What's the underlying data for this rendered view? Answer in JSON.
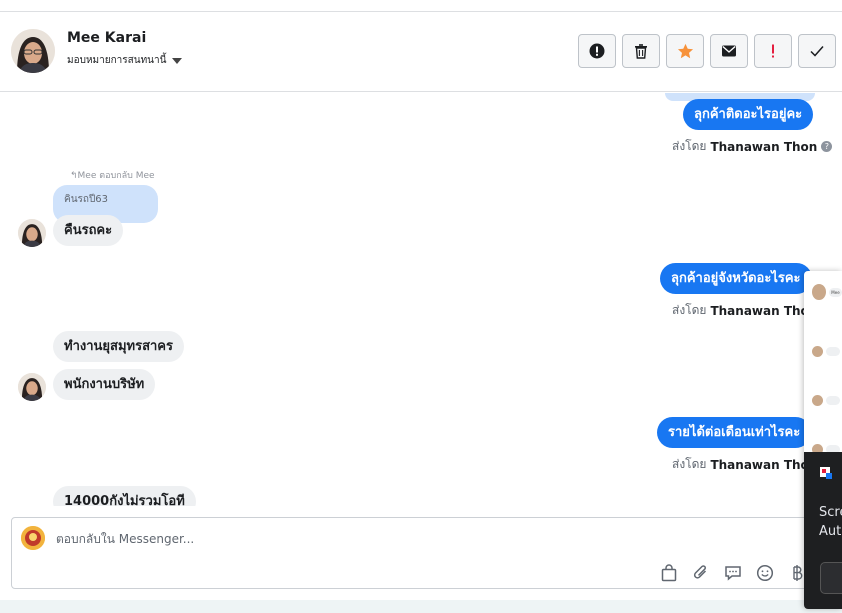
{
  "header": {
    "contact_name": "Mee Karai",
    "assign_label": "มอบหมายการสนทนานี้",
    "actions": [
      {
        "name": "spam-icon",
        "color": "#1c1e21"
      },
      {
        "name": "trash-icon",
        "color": "#1c1e21"
      },
      {
        "name": "star-icon",
        "color": "#f7923a"
      },
      {
        "name": "envelope-icon",
        "color": "#1c1e21"
      },
      {
        "name": "exclamation-icon",
        "color": "#e41e3f"
      },
      {
        "name": "check-icon",
        "color": "#1c1e21"
      }
    ]
  },
  "messages": {
    "out_1": "ลุกค้าติดอะไรอยู่คะ",
    "sent_by_prefix": "ส่งโดย",
    "agent_name": "Thanawan Thon",
    "reply_label": "Mee ตอบกลับ Mee",
    "quoted_text": "คินรถปี63",
    "in_1": "คืนรถคะ",
    "out_2": "ลุกค้าอยู่จังหวัดอะไรคะ",
    "in_2": "ทำงานยุสมุทรสาคร",
    "in_3": "พนักงานบริษัท",
    "out_3": "รายได้ต่อเดือนเท่าไรคะ",
    "in_4": "14000กังไม่รวมโอที"
  },
  "composer": {
    "placeholder": "ตอบกลับใน Messenger...",
    "tools": [
      "shopping-bag-icon",
      "paperclip-icon",
      "speech-bubble-icon",
      "emoji-icon",
      "baht-icon"
    ]
  },
  "popup": {
    "line_1": "Scre",
    "line_2": "Aut",
    "mini_name": "Mee"
  },
  "colors": {
    "accent": "#1877f2",
    "incoming_bubble": "#eef0f2",
    "quote_bubble": "#cfe2fb"
  }
}
